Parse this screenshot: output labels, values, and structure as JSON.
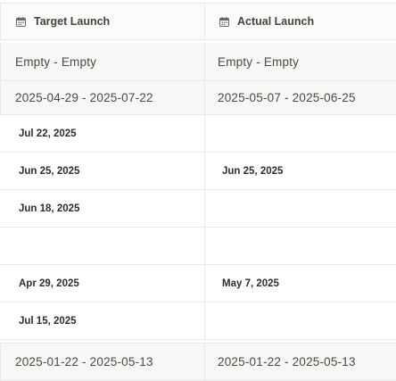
{
  "columns": {
    "target_label": "Target Launch",
    "actual_label": "Actual Launch",
    "icon": "calendar-icon"
  },
  "groups": [
    {
      "target": "Empty - Empty",
      "actual": "Empty - Empty"
    },
    {
      "target": "2025-04-29 - 2025-07-22",
      "actual": "2025-05-07 - 2025-06-25"
    },
    {
      "target": "2025-01-22 - 2025-05-13",
      "actual": "2025-01-22 - 2025-05-13"
    }
  ],
  "rows": [
    {
      "target": "Jul 22, 2025",
      "actual": ""
    },
    {
      "target": "Jun 25, 2025",
      "actual": "Jun 25, 2025"
    },
    {
      "target": "Jun 18, 2025",
      "actual": ""
    },
    {
      "target": "",
      "actual": ""
    },
    {
      "target": "Apr 29, 2025",
      "actual": "May 7, 2025"
    },
    {
      "target": "Jul 15, 2025",
      "actual": ""
    }
  ]
}
